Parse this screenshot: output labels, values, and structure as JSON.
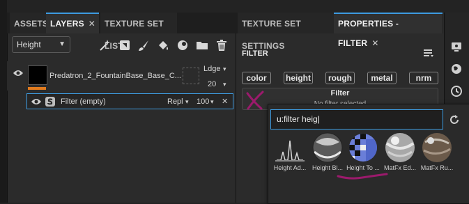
{
  "colors": {
    "accent": "#3d9be0",
    "layer_bar": "#e07a1e",
    "annotation": "#9b1a6c"
  },
  "left_panel": {
    "tabs": [
      {
        "label": "ASSETS"
      },
      {
        "label": "LAYERS",
        "close": "✕"
      },
      {
        "label": "TEXTURE SET LIST"
      }
    ],
    "channel_select": {
      "value": "Height"
    },
    "toolbar_icons": [
      "magic-wand-icon",
      "add-fill-layer-icon",
      "paint-brush-icon",
      "paint-bucket-icon",
      "add-effect-icon",
      "folder-icon",
      "trash-icon"
    ],
    "layer": {
      "name": "Predatron_2_FountainBase_Base_C...",
      "blend_mode": "Ldge",
      "opacity": "20"
    },
    "filter_row": {
      "label": "Filter (empty)",
      "blend": "Repl",
      "opacity": "100",
      "close": "✕"
    }
  },
  "right_panel": {
    "tabs": [
      {
        "label": "TEXTURE SET SETTINGS"
      },
      {
        "label": "PROPERTIES - FILTER",
        "close": "✕"
      }
    ],
    "section_title": "FILTER",
    "channel_chips": [
      "color",
      "height",
      "rough",
      "metal",
      "nrm"
    ],
    "filter_box": {
      "title": "Filter",
      "subtitle": "No filter selected"
    }
  },
  "popup": {
    "search_value": "u:filter heig",
    "results": [
      {
        "label": "Height Ad..."
      },
      {
        "label": "Height Bl..."
      },
      {
        "label": "Height To ..."
      },
      {
        "label": "MatFx Ed..."
      },
      {
        "label": "MatFx Ru..."
      }
    ]
  }
}
